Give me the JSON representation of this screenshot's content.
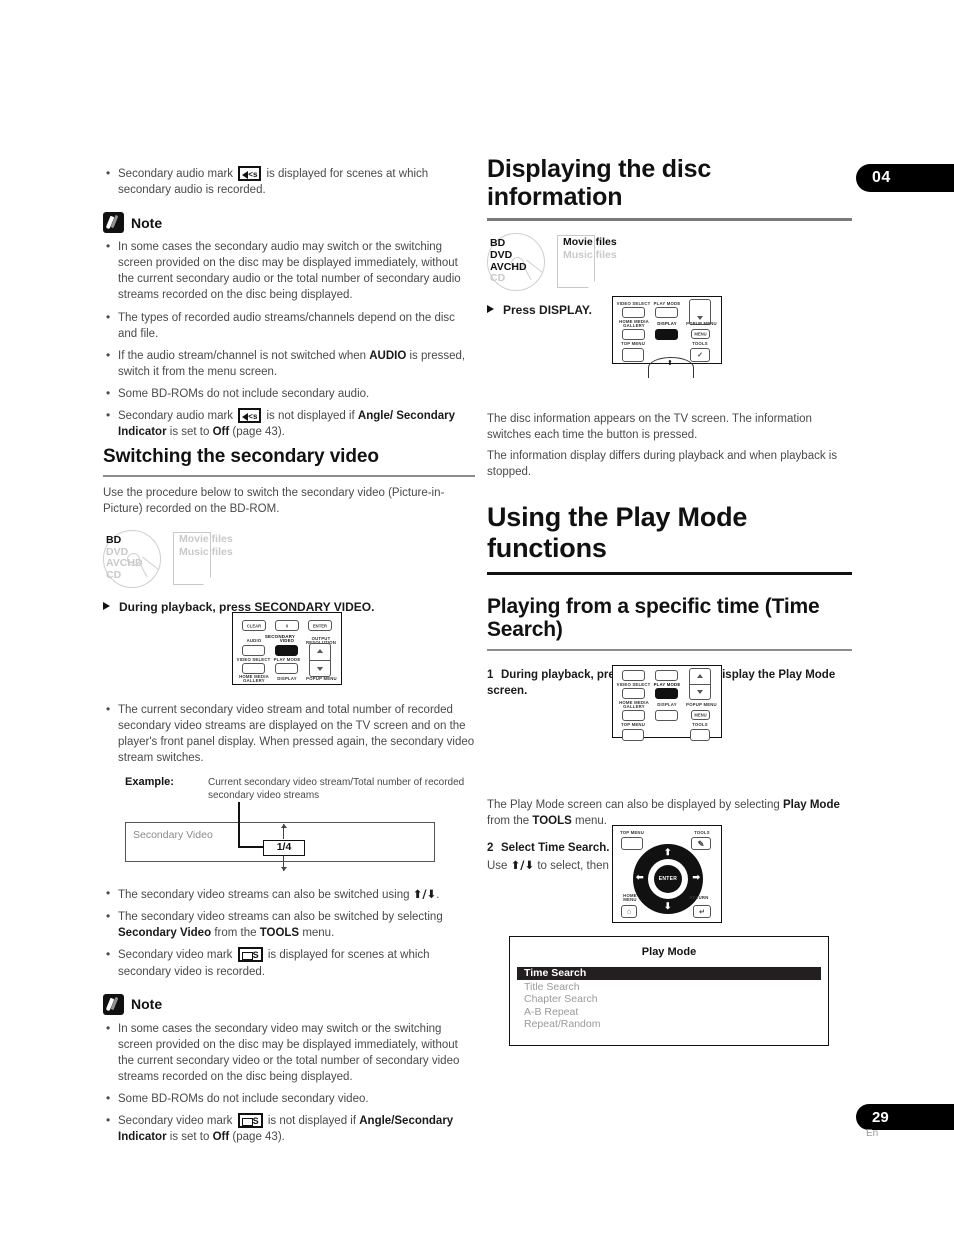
{
  "chapter": {
    "number": "04"
  },
  "footer": {
    "page": "29",
    "lang": "En"
  },
  "left_column": {
    "top_bullets": [
      {
        "pre": "Secondary audio mark",
        "mark": "secondary-audio-mark",
        "post": "is displayed for scenes at which secondary audio is recorded."
      }
    ],
    "note_label": "Note",
    "note_bullets": [
      "In some cases the secondary audio may switch or the switching screen provided on the disc may be displayed immediately, without the current secondary audio or the total number of secondary audio streams recorded on the disc being displayed.",
      "The types of recorded audio streams/channels depend on the disc and file.",
      "If the audio stream/channel is not switched when AUDIO is pressed, switch it from the menu screen.",
      "Some BD-ROMs do not include secondary audio."
    ],
    "note_last_bullet": {
      "pre": "Secondary audio mark",
      "mid": "is not displayed if",
      "bold1": "Angle/ Secondary Indicator",
      "mid2": "is set to",
      "bold2": "Off",
      "post": "(page 43)."
    },
    "section_title": "Switching the secondary video",
    "intro": "Use the procedure below to switch the secondary video (Picture-in-Picture) recorded on the BD-ROM.",
    "media": {
      "disc": [
        {
          "label": "BD",
          "active": true
        },
        {
          "label": "DVD",
          "active": false
        },
        {
          "label": "AVCHD",
          "active": false
        },
        {
          "label": "CD",
          "active": false
        }
      ],
      "sheet": [
        {
          "label": "Movie files",
          "active": false
        },
        {
          "label": "Music files",
          "active": false
        }
      ]
    },
    "action": "During playback, press SECONDARY VIDEO.",
    "remote1": {
      "keys": [
        {
          "label": "CLEAR",
          "highlight": false
        },
        {
          "label": "0",
          "highlight": false
        },
        {
          "label": "ENTER",
          "highlight": false
        },
        {
          "label": "AUDIO",
          "highlight": false
        },
        {
          "label": "VIDEO",
          "highlight": true
        },
        {
          "label": "OUTPUT RESOLUTION",
          "highlight": false
        },
        {
          "label": "VIDEO SELECT",
          "highlight": false
        },
        {
          "label": "PLAY MODE",
          "highlight": false
        },
        {
          "label": "HOME MEDIA GALLERY",
          "highlight": false
        },
        {
          "label": "DISPLAY",
          "highlight": false
        },
        {
          "label": "POPUP MENU",
          "highlight": false
        }
      ],
      "group_label": "SECONDARY"
    },
    "bullets_mid": [
      "The current secondary video stream and total number of recorded secondary video streams are displayed on the TV screen and on the player's front panel display. When pressed again, the secondary video stream switches."
    ],
    "example": {
      "label": "Example:",
      "caption": "Current secondary video stream/Total number of recorded secondary video streams",
      "box_text": "Secondary Video",
      "value": "1/4"
    },
    "bullets_after": [
      {
        "text": "The secondary video streams can also be switched using",
        "arrows": true,
        "tail": "."
      },
      {
        "pre": "The secondary video streams can also be switched by selecting",
        "bold1": "Secondary Video",
        "mid": "from the",
        "bold2": "TOOLS",
        "post": "menu."
      },
      {
        "pre": "Secondary video mark",
        "mark": "secondary-video-mark",
        "post": "is displayed for scenes at which secondary video is recorded."
      }
    ],
    "note2_label": "Note",
    "note2_bullets": [
      "In some cases the secondary video may switch or the switching screen provided on the disc may be displayed immediately, without the current secondary video or the total number of secondary video streams recorded on the disc being displayed.",
      "Some BD-ROMs do not include secondary video."
    ],
    "note2_last_bullet": {
      "pre": "Secondary video mark",
      "mid": "is not displayed if",
      "bold1": "Angle/Secondary Indicator",
      "mid2": "is set to",
      "bold2": "Off",
      "post": "(page 43)."
    }
  },
  "right_column": {
    "title_disc_info": "Displaying the disc information",
    "media": {
      "disc": [
        {
          "label": "BD",
          "active": true
        },
        {
          "label": "DVD",
          "active": true
        },
        {
          "label": "AVCHD",
          "active": true
        },
        {
          "label": "CD",
          "active": false
        }
      ],
      "sheet": [
        {
          "label": "Movie files",
          "active": true
        },
        {
          "label": "Music files",
          "active": false
        }
      ]
    },
    "action_display": "Press DISPLAY.",
    "remote2": {
      "keys": [
        {
          "label": "VIDEO SELECT",
          "highlight": false
        },
        {
          "label": "PLAY MODE",
          "highlight": false
        },
        {
          "label": "HOME MEDIA GALLERY",
          "highlight": false
        },
        {
          "label": "DISPLAY",
          "highlight": true
        },
        {
          "label": "POPUP MENU",
          "highlight": false
        },
        {
          "label": "TOP MENU",
          "highlight": false
        },
        {
          "label": "TOOLS",
          "highlight": false
        },
        {
          "label": "MENU",
          "highlight": false
        }
      ]
    },
    "para1": "The disc information appears on the TV screen. The information switches each time the button is pressed.",
    "para2": "The information display differs during playback and when playback is stopped.",
    "title_play_mode": "Using the Play Mode functions",
    "title_time_search": "Playing from a specific time (Time Search)",
    "step1": {
      "num": "1",
      "text": "During playback, press PLAY MODE to display the Play Mode screen."
    },
    "remote3": {
      "keys": [
        {
          "label": "VIDEO SELECT",
          "highlight": false
        },
        {
          "label": "PLAY MODE",
          "highlight": true
        },
        {
          "label": "HOME MEDIA GALLERY",
          "highlight": false
        },
        {
          "label": "DISPLAY",
          "highlight": false
        },
        {
          "label": "POPUP MENU",
          "highlight": false
        },
        {
          "label": "TOP MENU",
          "highlight": false
        },
        {
          "label": "TOOLS",
          "highlight": false
        },
        {
          "label": "MENU",
          "highlight": false
        }
      ]
    },
    "para3": {
      "pre": "The Play Mode screen can also be displayed by selecting",
      "bold1": "Play Mode",
      "mid": "from the",
      "bold2": "TOOLS",
      "post": "menu."
    },
    "step2": {
      "num": "2",
      "text": "Select Time Search."
    },
    "step2_sub": {
      "pre": "Use",
      "mid": "to select, then press",
      "bold": "ENTER",
      "post": "."
    },
    "remote4": {
      "keys": [
        {
          "label": "TOP MENU",
          "highlight": false
        },
        {
          "label": "TOOLS",
          "highlight": false
        },
        {
          "label": "HOME MENU",
          "highlight": false
        },
        {
          "label": "RETURN",
          "highlight": false
        },
        {
          "label": "ENTER",
          "highlight": true
        }
      ]
    },
    "play_mode_dialog": {
      "title": "Play Mode",
      "items": [
        {
          "label": "Time Search",
          "selected": true
        },
        {
          "label": "Title Search",
          "selected": false
        },
        {
          "label": "Chapter Search",
          "selected": false
        },
        {
          "label": "A-B Repeat",
          "selected": false
        },
        {
          "label": "Repeat/Random",
          "selected": false
        }
      ]
    }
  },
  "colors": {
    "accent": "#000000",
    "highlight": "#231f20",
    "muted": "#9a9a9a"
  }
}
